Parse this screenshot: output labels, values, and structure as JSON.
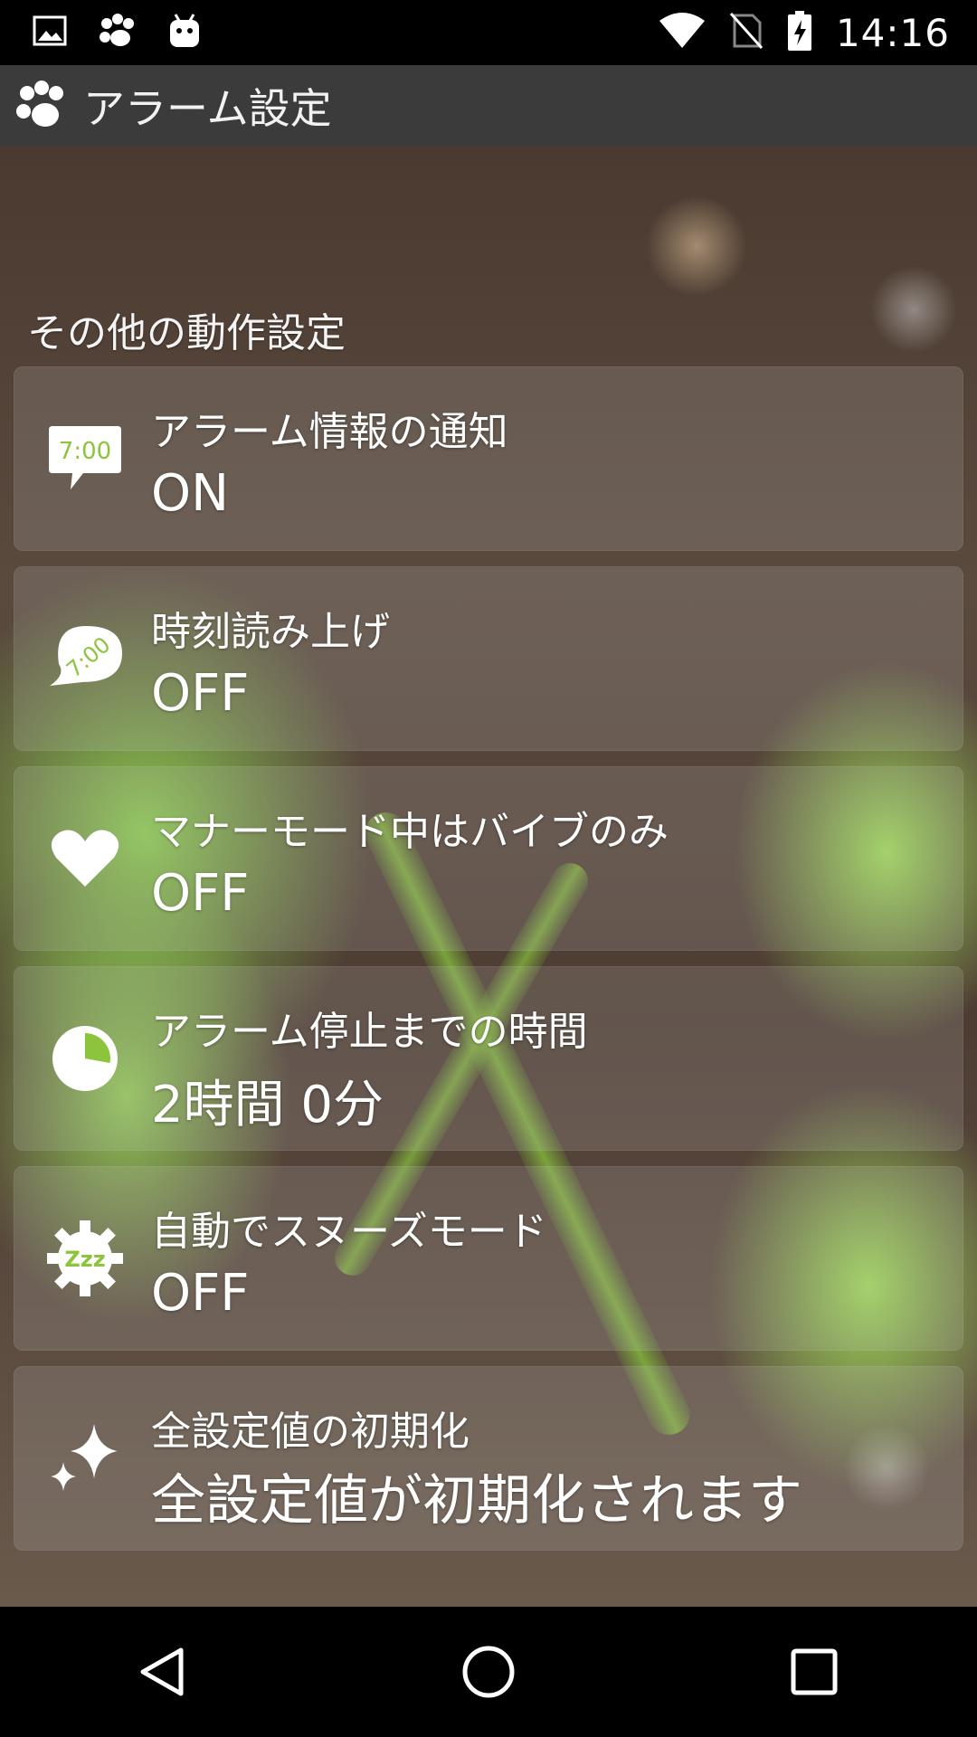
{
  "status_bar": {
    "time": "14:16",
    "left_icons": [
      "image-icon",
      "paw-icon",
      "android-icon"
    ],
    "right_icons": [
      "wifi-icon",
      "no-sim-icon",
      "battery-charging-icon"
    ]
  },
  "app_bar": {
    "title": "アラーム設定",
    "icon": "paw-logo-icon"
  },
  "section": {
    "header": "その他の動作設定"
  },
  "items": [
    {
      "icon": "notification-clock-bubble-icon",
      "icon_text": "7:00",
      "label": "アラーム情報の通知",
      "value": "ON"
    },
    {
      "icon": "speech-clock-bubble-icon",
      "icon_text": "7:00",
      "label": "時刻読み上げ",
      "value": "OFF"
    },
    {
      "icon": "heart-icon",
      "label": "マナーモード中はバイブのみ",
      "value": "OFF"
    },
    {
      "icon": "pie-clock-icon",
      "label": "アラーム停止までの時間",
      "value": "2時間 0分"
    },
    {
      "icon": "snooze-gear-icon",
      "icon_text": "Zzz",
      "label": "自動でスヌーズモード",
      "value": "OFF"
    },
    {
      "icon": "sparkle-icon",
      "label": "全設定値の初期化",
      "value": "全設定値が初期化されます"
    }
  ],
  "nav_bar": {
    "buttons": [
      "back-icon",
      "home-icon",
      "recents-icon"
    ]
  }
}
